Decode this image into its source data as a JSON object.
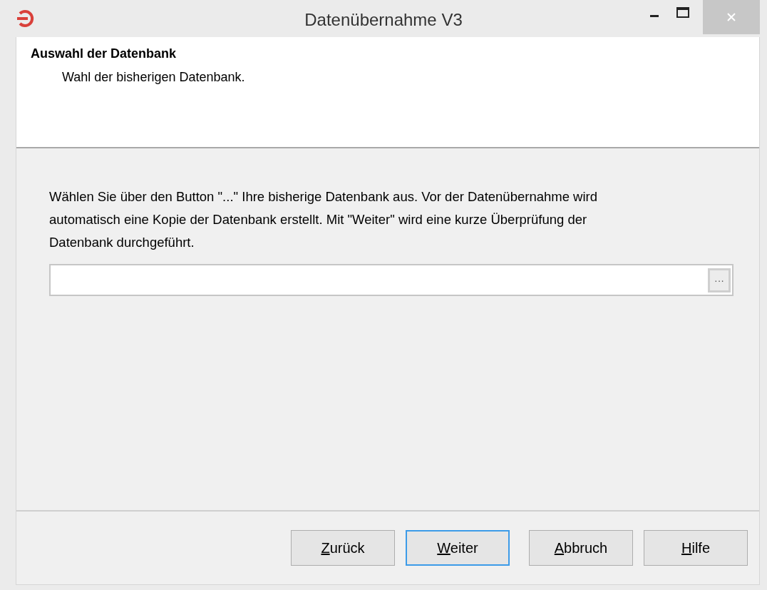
{
  "window": {
    "title": "Datenübernahme V3"
  },
  "header": {
    "title": "Auswahl der Datenbank",
    "subtitle": "Wahl der bisherigen Datenbank."
  },
  "body": {
    "instructions": "Wählen Sie über den Button \"...\" Ihre bisherige Datenbank aus. Vor der Datenübernahme wird automatisch eine Kopie der Datenbank erstellt. Mit \"Weiter\" wird eine kurze Überprüfung der Datenbank durchgeführt.",
    "browse_button": "···"
  },
  "buttons": [
    {
      "mnemonic": "Z",
      "rest": "urück",
      "focused": false
    },
    {
      "mnemonic": "W",
      "rest": "eiter",
      "focused": true
    },
    {
      "mnemonic": "A",
      "rest": "bbruch",
      "focused": false
    },
    {
      "mnemonic": "H",
      "rest": "ilfe",
      "focused": false
    }
  ]
}
